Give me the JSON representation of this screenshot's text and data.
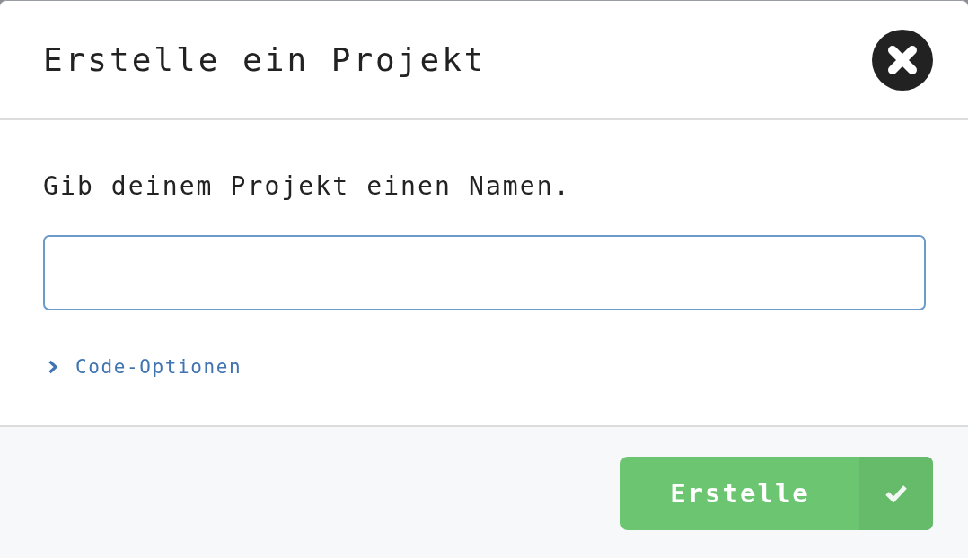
{
  "dialog": {
    "title": "Erstelle ein Projekt"
  },
  "prompt": "Gib deinem Projekt einen Namen.",
  "code_options": {
    "label": "Code-Optionen",
    "expanded": false
  },
  "submit_button": {
    "label": "Erstelle"
  }
}
